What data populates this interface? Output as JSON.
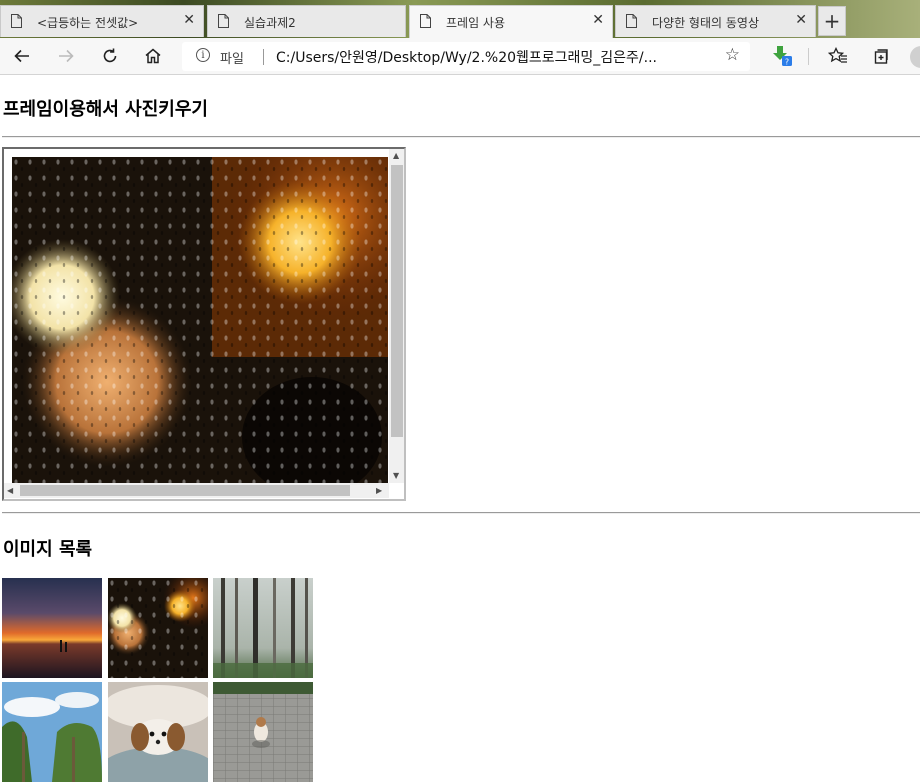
{
  "tabs": [
    {
      "title": "<급등하는 전셋값>",
      "active": false
    },
    {
      "title": "실습과제2",
      "active": false
    },
    {
      "title": "프레임 사용",
      "active": true
    },
    {
      "title": "다양한 형태의 동영상",
      "active": false
    }
  ],
  "address": {
    "scheme_label": "파일",
    "url": "C:/Users/안원영/Desktop/Wy/2.%20웹프로그래밍_김은주/..."
  },
  "page": {
    "heading": "프레임이용해서 사진키우기",
    "list_heading": "이미지 목록"
  },
  "colors": {
    "accent": "#1a73e8",
    "extension_badge": "#2b7de9"
  },
  "icons": [
    "back-icon",
    "forward-icon",
    "refresh-icon",
    "home-icon",
    "info-icon",
    "star-icon",
    "extension-icon",
    "favorites-icon",
    "collections-icon"
  ],
  "images": [
    "sunset-sea",
    "rain-bokeh",
    "foggy-forest",
    "palm-trees-sky",
    "puppy-blanket",
    "puppy-pavement"
  ]
}
